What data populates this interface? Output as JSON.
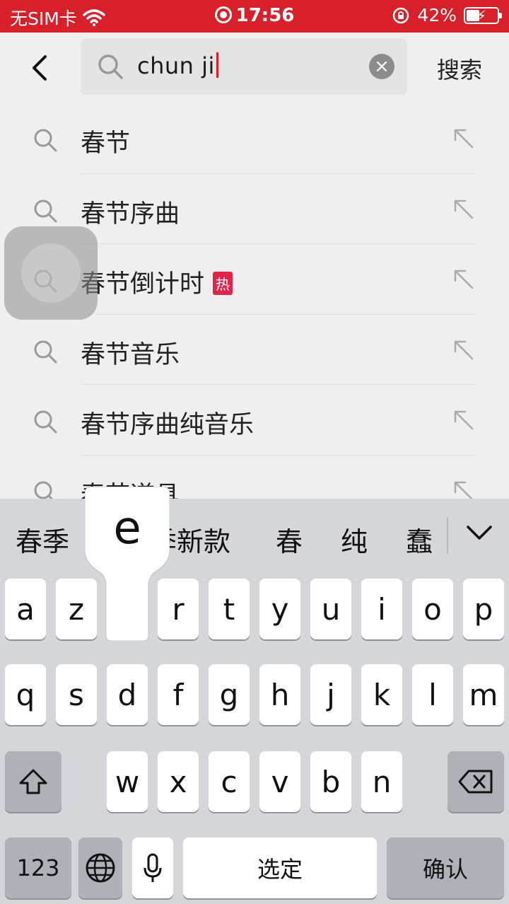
{
  "status_bar": {
    "carrier": "无SIM卡",
    "time": "17:56",
    "battery": "42%",
    "battery_level": 0.42
  },
  "search": {
    "query": "chun ji",
    "submit_label": "搜索"
  },
  "suggestions": [
    {
      "text": "春节",
      "hot": false
    },
    {
      "text": "春节序曲",
      "hot": false
    },
    {
      "text": "春节倒计时",
      "hot": true
    },
    {
      "text": "春节音乐",
      "hot": false
    },
    {
      "text": "春节序曲纯音乐",
      "hot": false
    },
    {
      "text": "春节道具",
      "hot": false
    }
  ],
  "hot_badge_label": "热",
  "keyboard": {
    "candidates": [
      "春季",
      "春季新款",
      "春",
      "纯",
      "蠢"
    ],
    "popup_key": "e",
    "row1": [
      "a",
      "z",
      "e",
      "r",
      "t",
      "y",
      "u",
      "i",
      "o",
      "p"
    ],
    "row2": [
      "q",
      "s",
      "d",
      "f",
      "g",
      "h",
      "j",
      "k",
      "l",
      "m"
    ],
    "row3": [
      "w",
      "x",
      "c",
      "v",
      "b",
      "n"
    ],
    "numbers_label": "123",
    "space_label": "选定",
    "confirm_label": "确认"
  }
}
